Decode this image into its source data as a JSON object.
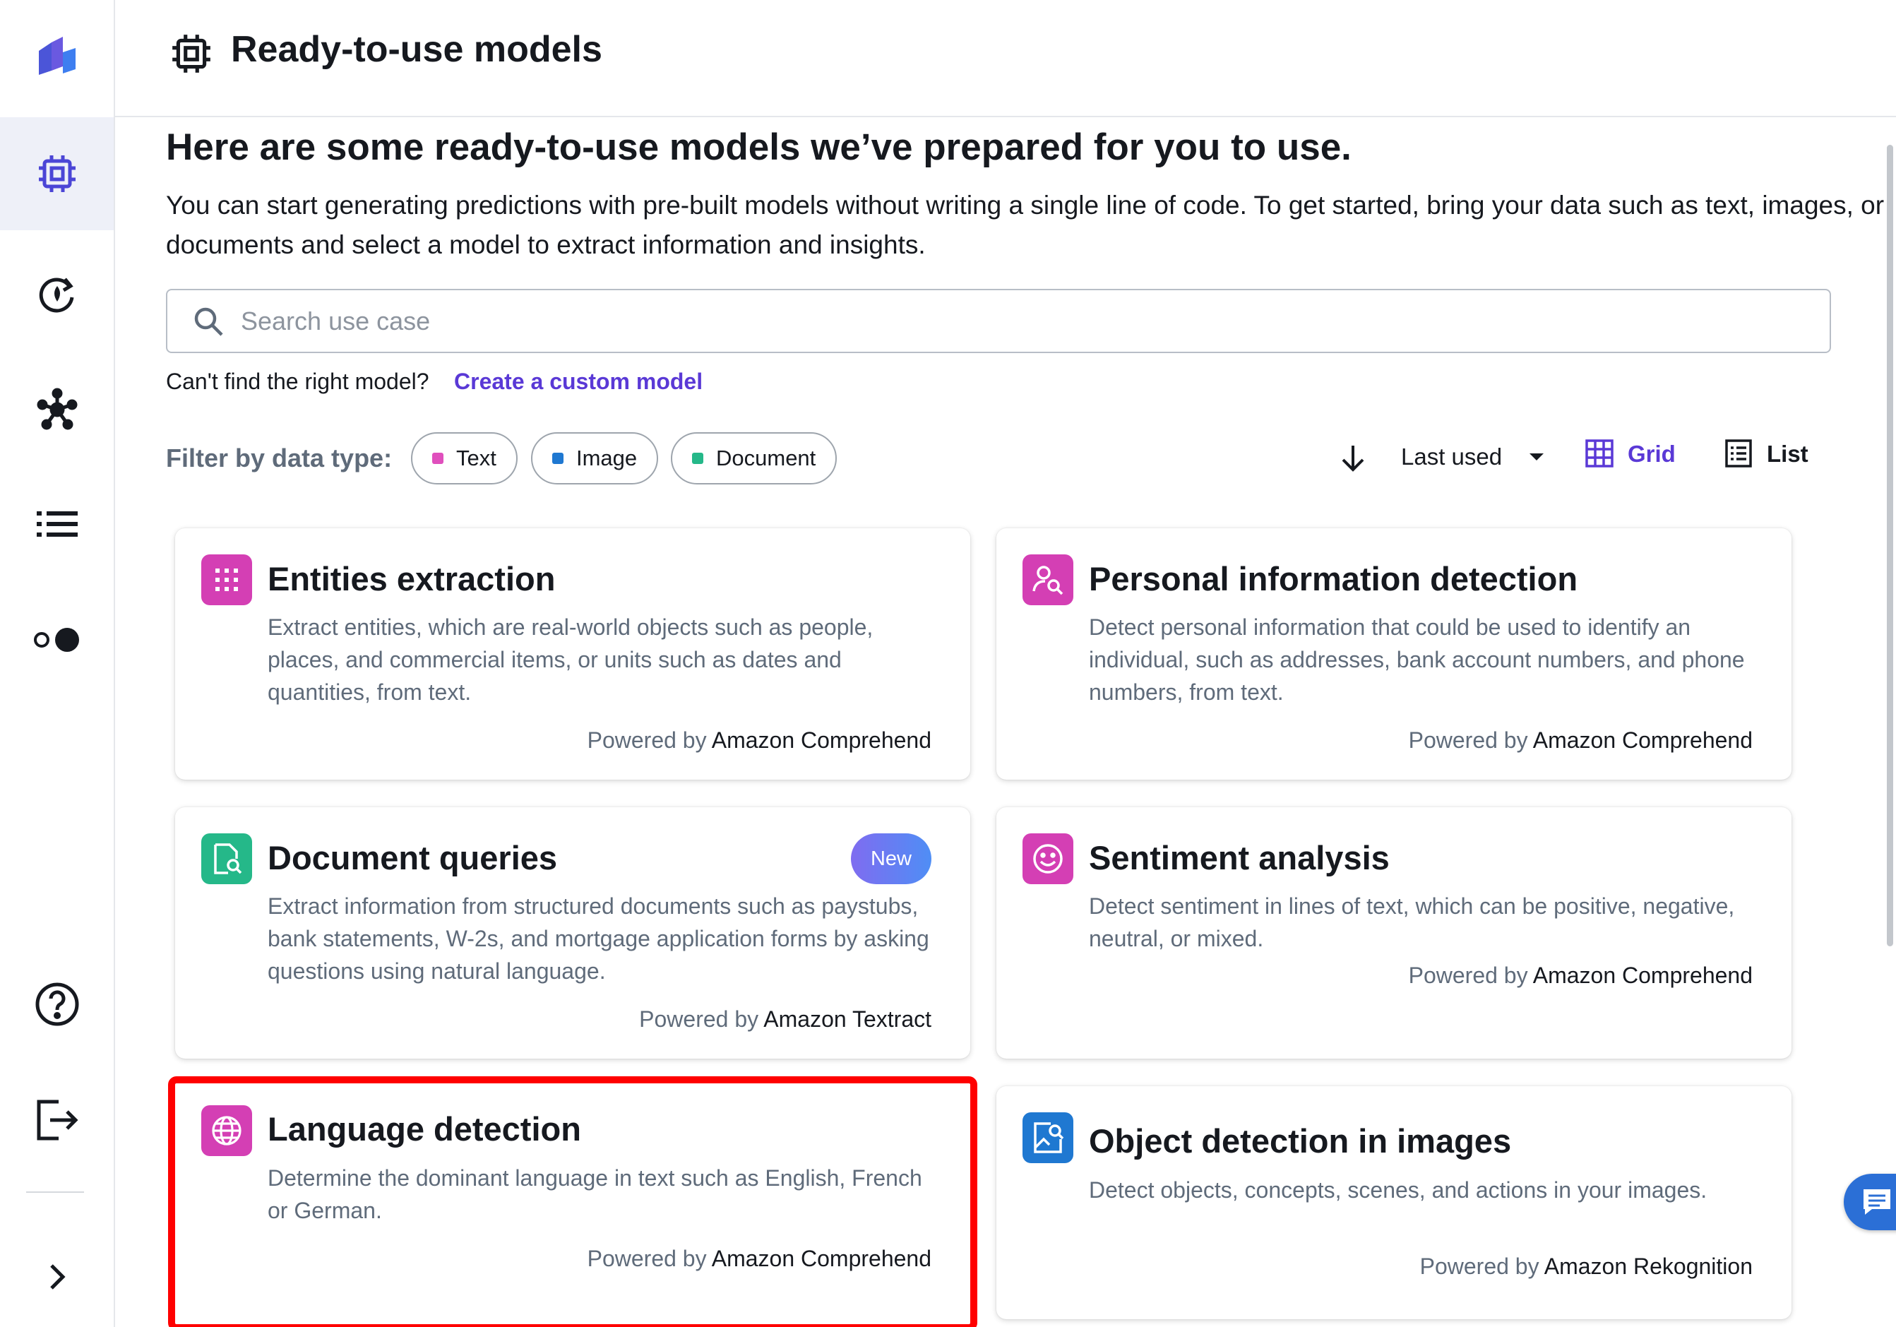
{
  "colors": {
    "accent": "#5a39d6",
    "text_chip": "#e04fbd",
    "image_chip": "#1f78d1",
    "document_chip": "#25b889",
    "highlight": "#ff0000",
    "new_badge_start": "#7f6cf0",
    "new_badge_end": "#4f8ef5"
  },
  "sidebar": {
    "items": [
      {
        "icon": "app-logo-icon"
      },
      {
        "icon": "chip-icon",
        "active": true
      },
      {
        "icon": "refresh-icon"
      },
      {
        "icon": "network-icon"
      },
      {
        "icon": "list-icon"
      },
      {
        "icon": "toggle-icon"
      },
      {
        "icon": "help-icon"
      },
      {
        "icon": "sign-out-icon"
      },
      {
        "icon": "chevron-right-icon"
      }
    ]
  },
  "header": {
    "title": "Ready-to-use models",
    "icon": "chip-icon"
  },
  "main": {
    "title": "Here are some ready-to-use models we’ve prepared for you to use.",
    "description": "You can start generating predictions with pre-built models without writing a single line of code. To get started, bring your data such as text, images, or documents and select a model to extract information and insights.",
    "search": {
      "placeholder": "Search use case",
      "value": ""
    },
    "cant_find": "Can't find the right model?",
    "create_link": "Create a custom model",
    "filter": {
      "label": "Filter by data type:",
      "chips": [
        "Text",
        "Image",
        "Document"
      ]
    },
    "sort": {
      "label": "Last used"
    },
    "views": {
      "grid": "Grid",
      "list": "List",
      "selected": "Grid"
    }
  },
  "cards": [
    {
      "title": "Entities extraction",
      "icon": "entities-icon",
      "description": "Extract entities, which are real-world objects such as people, places, and commercial items, or units such as dates and quantities, from text.",
      "powered_prefix": "Powered by",
      "service": "Amazon Comprehend"
    },
    {
      "title": "Personal information detection",
      "icon": "person-search-icon",
      "description": "Detect personal information that could be used to identify an individual, such as addresses, bank account numbers, and phone numbers, from text.",
      "powered_prefix": "Powered by",
      "service": "Amazon Comprehend"
    },
    {
      "title": "Document queries",
      "icon": "document-search-icon",
      "badge": "New",
      "description": "Extract information from structured documents such as paystubs, bank statements, W-2s, and mortgage application forms by asking questions using natural language.",
      "powered_prefix": "Powered by",
      "service": "Amazon Textract"
    },
    {
      "title": "Sentiment analysis",
      "icon": "smiley-icon",
      "description": "Detect sentiment in lines of text, which can be positive, negative, neutral, or mixed.",
      "powered_prefix": "Powered by",
      "service": "Amazon Comprehend"
    },
    {
      "title": "Language detection",
      "icon": "globe-icon",
      "highlighted": true,
      "description": "Determine the dominant language in text such as English, French or German.",
      "powered_prefix": "Powered by",
      "service": "Amazon Comprehend"
    },
    {
      "title": "Object detection in images",
      "icon": "image-search-icon",
      "description": "Detect objects, concepts, scenes, and actions in your images.",
      "powered_prefix": "Powered by",
      "service": "Amazon Rekognition"
    }
  ],
  "chat": {
    "icon": "chat-icon"
  }
}
